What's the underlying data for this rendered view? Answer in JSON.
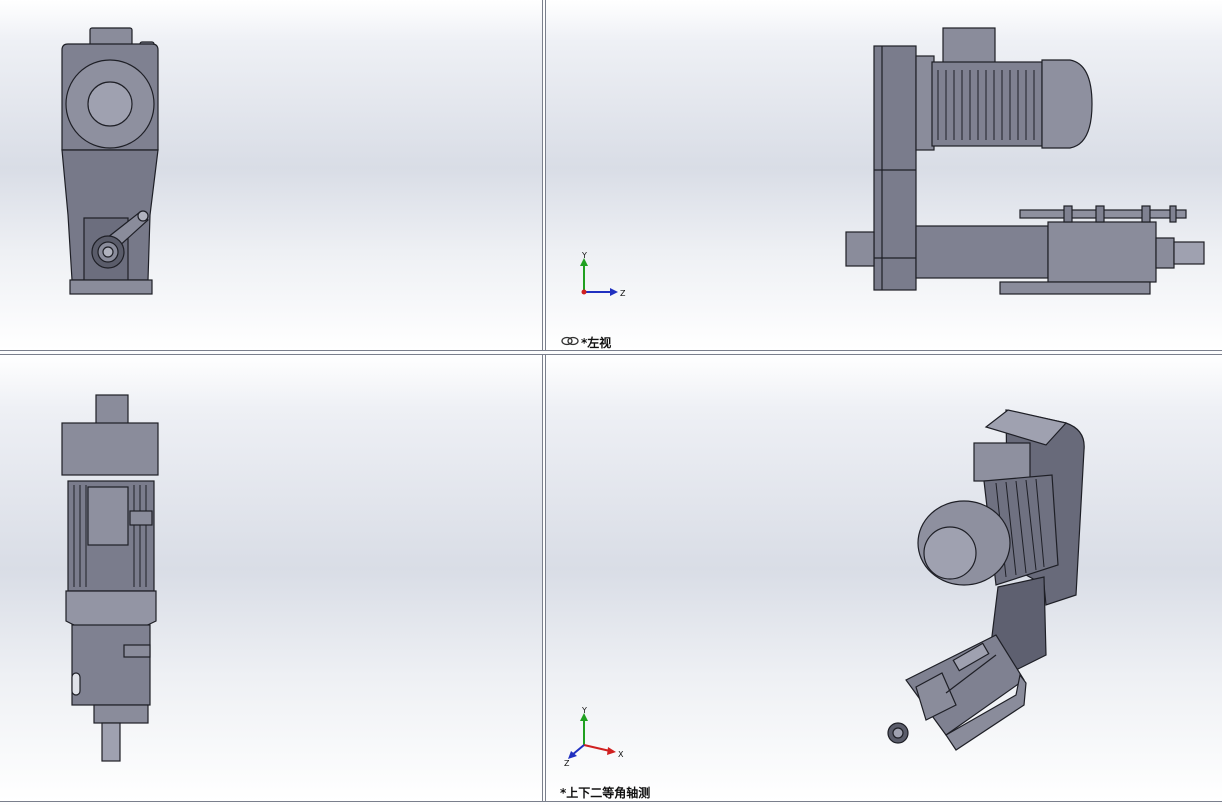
{
  "viewports": {
    "front": {
      "label": ""
    },
    "left": {
      "label": "*左视"
    },
    "top": {
      "label": ""
    },
    "isometric": {
      "label": "*上下二等角轴测"
    }
  },
  "triads": {
    "left": {
      "axis_up": "Y",
      "axis_right": "Z"
    },
    "isometric": {
      "axis_up": "Y",
      "axis_right": "X",
      "axis_out": "Z"
    }
  },
  "icons": {
    "view_link": "chain-link-icon"
  },
  "colors": {
    "model_fill": "#7f8191",
    "model_dark": "#4a4c5a",
    "model_light": "#9fa1b0",
    "edge": "#1e1f26",
    "axis_x": "#d02020",
    "axis_y": "#20a020",
    "axis_z": "#2030c0"
  }
}
